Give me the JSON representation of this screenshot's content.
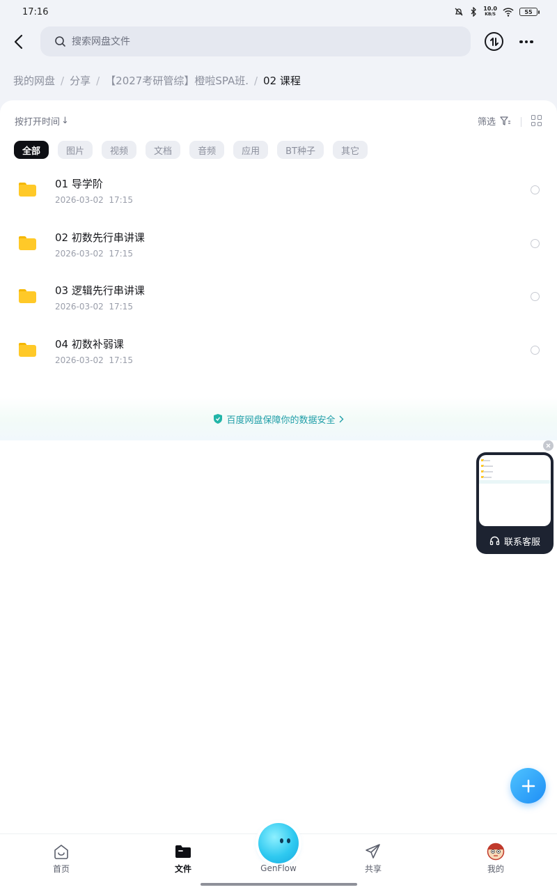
{
  "status_bar": {
    "time": "17:16",
    "net_speed": "10.0",
    "net_unit": "KB/S",
    "battery": "55"
  },
  "search": {
    "placeholder": "搜索网盘文件"
  },
  "breadcrumb": {
    "items": [
      "我的网盘",
      "分享",
      "【2027考研管综】橙啦SPA班."
    ],
    "current": "02 课程"
  },
  "toolbar": {
    "sort_label": "按打开时间",
    "sort_arrow": "↓",
    "filter_label": "筛选"
  },
  "chips": [
    "全部",
    "图片",
    "视频",
    "文档",
    "音频",
    "应用",
    "BT种子",
    "其它"
  ],
  "files": [
    {
      "name": "01 导学阶",
      "date": "2026-03-02  17:15"
    },
    {
      "name": "02 初数先行串讲课",
      "date": "2026-03-02  17:15"
    },
    {
      "name": "03 逻辑先行串讲课",
      "date": "2026-03-02  17:15"
    },
    {
      "name": "04 初数补弱课",
      "date": "2026-03-02  17:15"
    }
  ],
  "safety_banner": {
    "text": "百度网盘保障你的数据安全",
    "color": "#1f9ea8"
  },
  "service_widget": {
    "label": "联系客服"
  },
  "nav": {
    "home": "首页",
    "files": "文件",
    "genflow": "GenFlow",
    "share": "共享",
    "me": "我的"
  },
  "colors": {
    "accent": "#1e8ef5",
    "folder": "#ffc928",
    "active_chip": "#0e0f14"
  }
}
